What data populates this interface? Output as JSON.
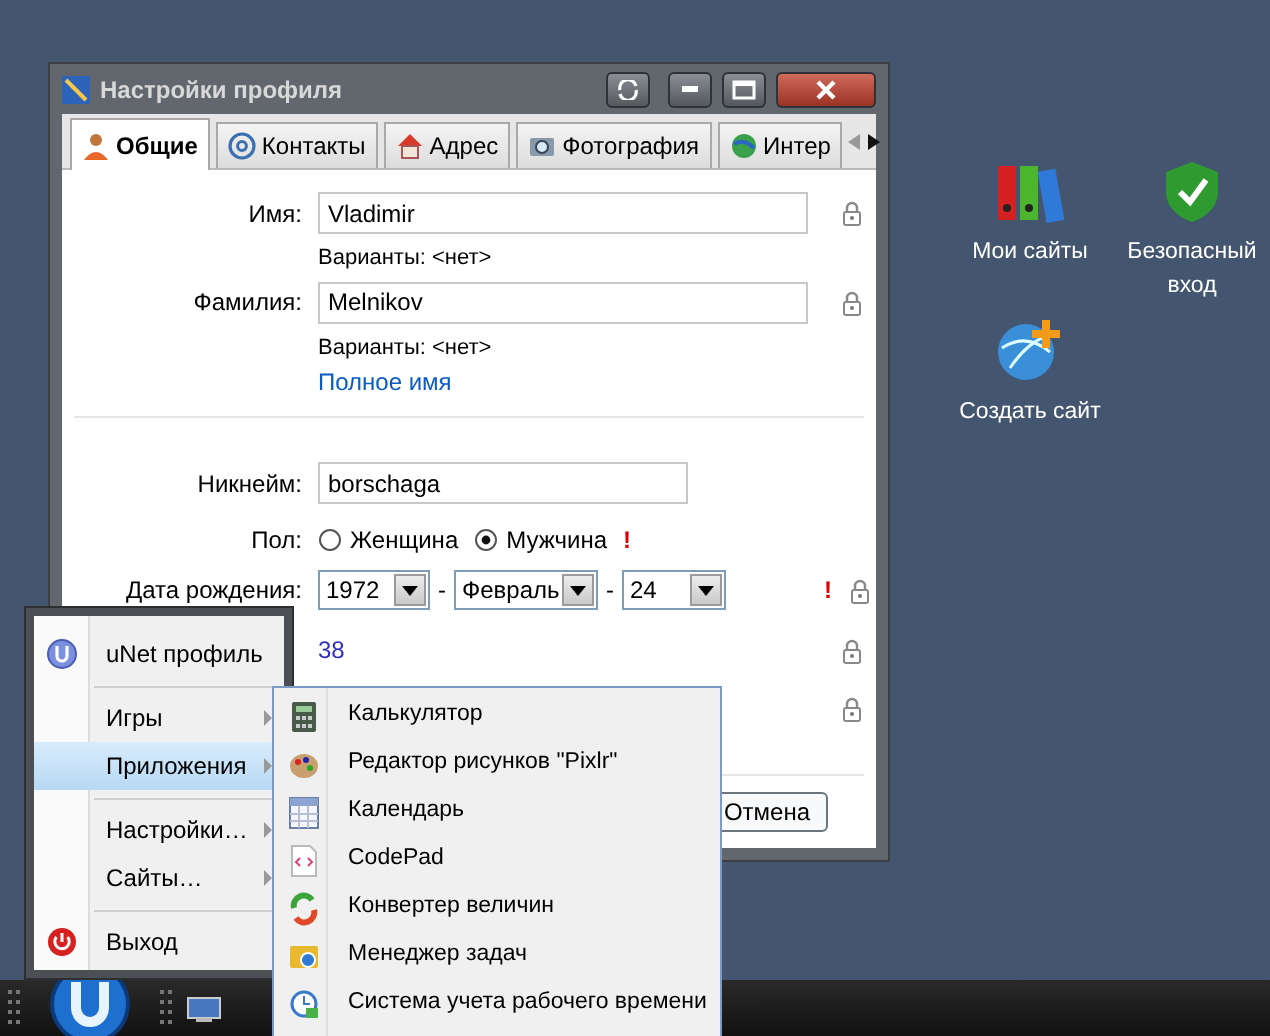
{
  "window": {
    "title": "Настройки профиля",
    "tabs": [
      {
        "label": "Общие",
        "selected": true
      },
      {
        "label": "Контакты",
        "selected": false
      },
      {
        "label": "Адрес",
        "selected": false
      },
      {
        "label": "Фотография",
        "selected": false
      },
      {
        "label": "Интер",
        "selected": false
      }
    ],
    "form": [
      {
        "kind": "text",
        "label": "Имя:",
        "value": "Vladimir",
        "hint": "Варианты: <нет>",
        "lock": true
      },
      {
        "kind": "text",
        "label": "Фамилия:",
        "value": "Melnikov",
        "hint": "Варианты: <нет>",
        "lock": true
      },
      {
        "kind": "link",
        "value": "Полное имя",
        "lock": false
      },
      {
        "kind": "divider",
        "lock": false
      },
      {
        "kind": "short_text",
        "label": "Никнейм:",
        "value": "borschaga",
        "lock": false
      },
      {
        "kind": "radio",
        "label": "Пол:",
        "options": [
          {
            "label": "Женщина",
            "selected": false
          },
          {
            "label": "Мужчина",
            "selected": true
          }
        ],
        "required_mark": "!",
        "lock": false
      },
      {
        "kind": "date",
        "label": "Дата рождения:",
        "parts": [
          "1972",
          "Февраль",
          "24"
        ],
        "joiner": "-",
        "required_mark": "!",
        "lock": true
      },
      {
        "kind": "value",
        "value": "38",
        "lock": true
      },
      {
        "kind": "blank",
        "lock": true
      }
    ],
    "buttons": [
      "Отмена"
    ]
  },
  "desktop_icons": [
    {
      "label": "Мои сайты"
    },
    {
      "label": "Безопасный вход"
    },
    {
      "label": "Создать сайт"
    }
  ],
  "start_menu": [
    {
      "kind": "profile",
      "label": "uNet профиль"
    },
    {
      "kind": "separator"
    },
    {
      "kind": "submenu",
      "label": "Игры",
      "selected": false
    },
    {
      "kind": "submenu",
      "label": "Приложения",
      "selected": true
    },
    {
      "kind": "separator"
    },
    {
      "kind": "submenu",
      "label": "Настройки…",
      "selected": false
    },
    {
      "kind": "submenu",
      "label": "Сайты…",
      "selected": false
    },
    {
      "kind": "separator"
    },
    {
      "kind": "exit",
      "label": "Выход"
    }
  ],
  "applications_menu": [
    {
      "label": "Калькулятор"
    },
    {
      "label": "Редактор рисунков \"Pixlr\""
    },
    {
      "label": "Календарь"
    },
    {
      "label": "CodePad"
    },
    {
      "label": "Конвертер величин"
    },
    {
      "label": "Менеджер задач"
    },
    {
      "label": "Система учета рабочего времени"
    }
  ]
}
